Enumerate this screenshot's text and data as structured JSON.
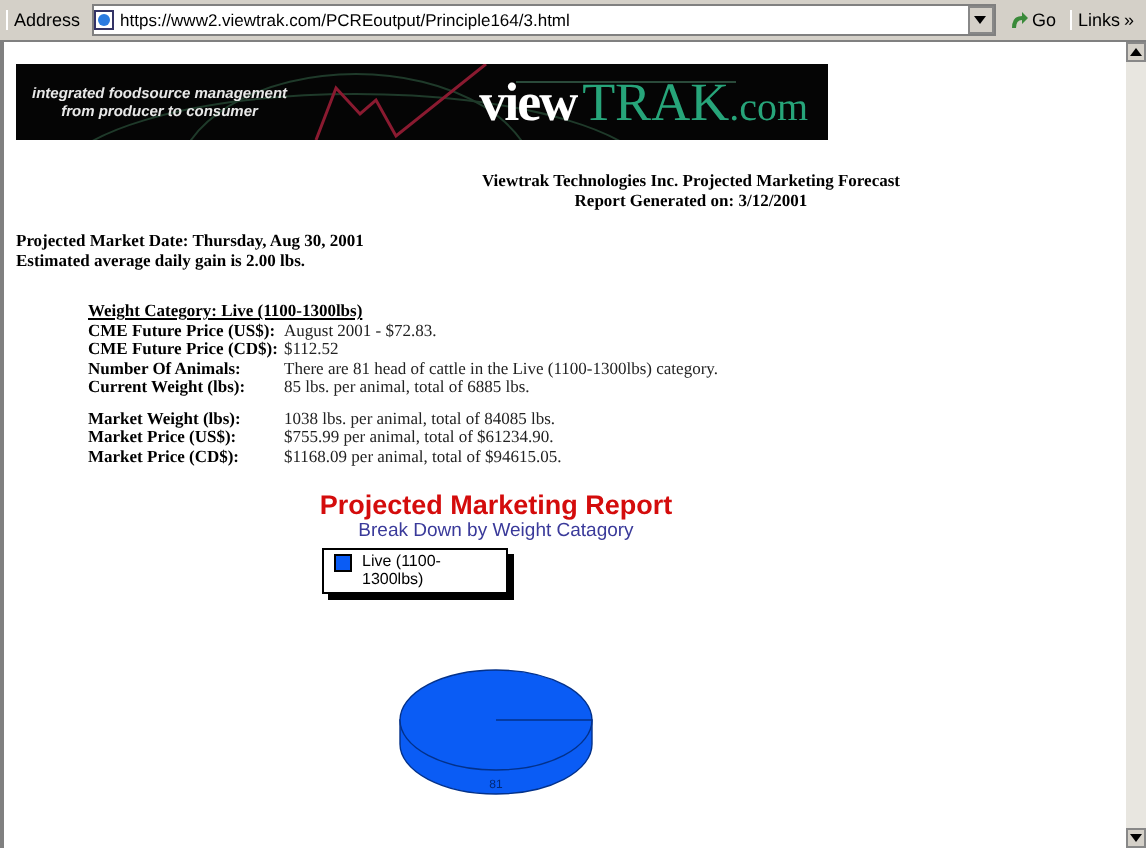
{
  "address_bar": {
    "label": "Address",
    "url": "https://www2.viewtrak.com/PCREoutput/Principle164/3.html",
    "go": "Go",
    "links": "Links",
    "links_more": "»"
  },
  "banner": {
    "tagline": [
      "integrated foodsource management",
      "from producer to consumer"
    ],
    "logo_view": "view",
    "logo_trak": "TRAK",
    "logo_com": ".com"
  },
  "report": {
    "title": "Viewtrak Technologies Inc. Projected Marketing Forecast",
    "generated": "Report Generated on: 3/12/2001",
    "market_date": "Projected Market Date: Thursday, Aug 30, 2001",
    "daily_gain": "Estimated average daily gain is 2.00 lbs."
  },
  "category_heading": "Weight Category: Live (1100-1300lbs)",
  "details": [
    [
      {
        "label": "CME Future Price (US$):",
        "value": "August 2001 - $72.83."
      },
      {
        "label": "CME Future Price (CD$):",
        "value": "$112.52"
      },
      {
        "label": "Number Of Animals:",
        "value": "There are 81 head of cattle in the Live (1100-1300lbs) category."
      },
      {
        "label": "Current Weight (lbs):",
        "value": "85 lbs. per animal, total of 6885 lbs."
      }
    ],
    [
      {
        "label": "Market Weight (lbs):",
        "value": "1038 lbs. per animal, total of 84085 lbs."
      },
      {
        "label": "Market Price (US$):",
        "value": "$755.99 per animal, total of $61234.90."
      },
      {
        "label": "Market Price (CD$):",
        "value": "$1168.09 per animal, total of $94615.05."
      }
    ]
  ],
  "chart": {
    "chart_data": {
      "type": "pie",
      "title": "Projected Marketing Report",
      "xlabel": "Break Down by Weight Catagory",
      "categories": [
        "Live (1100-1300lbs)"
      ],
      "series": [
        {
          "color": "#0a5cf5",
          "values": [
            81
          ]
        }
      ],
      "data_labels": true
    }
  }
}
